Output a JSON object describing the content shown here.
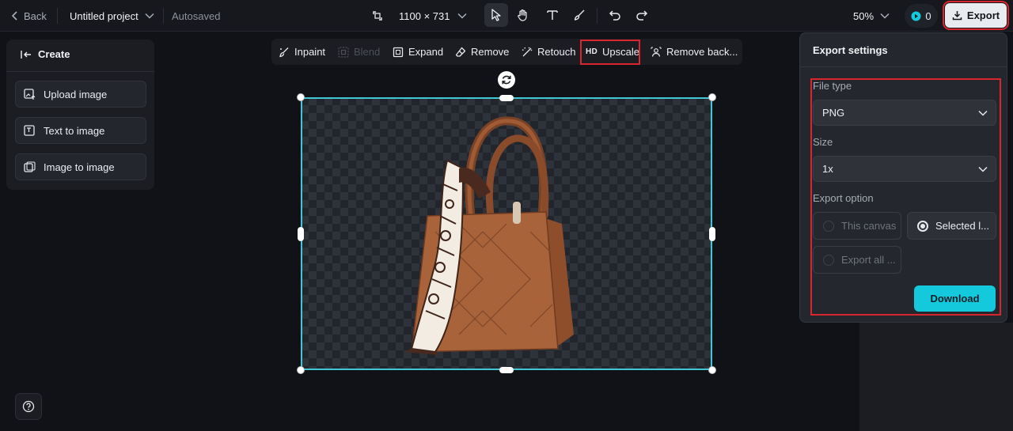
{
  "topbar": {
    "back_label": "Back",
    "project_title": "Untitled project",
    "autosave_status": "Autosaved",
    "canvas_size": "1100 × 731",
    "zoom": "50%",
    "credits": "0",
    "export_label": "Export"
  },
  "left_panel": {
    "header": "Create",
    "items": [
      {
        "label": "Upload image",
        "icon": "upload-image-icon"
      },
      {
        "label": "Text to image",
        "icon": "text-to-image-icon"
      },
      {
        "label": "Image to image",
        "icon": "image-to-image-icon"
      }
    ]
  },
  "canvas_toolbar": {
    "items": [
      {
        "label": "Inpaint",
        "disabled": false
      },
      {
        "label": "Blend",
        "disabled": true
      },
      {
        "label": "Expand",
        "disabled": false
      },
      {
        "label": "Remove",
        "disabled": false
      },
      {
        "label": "Retouch",
        "disabled": false
      },
      {
        "label": "Upscale",
        "badge": "HD",
        "disabled": false,
        "highlighted": true
      },
      {
        "label": "Remove back...",
        "disabled": false
      }
    ]
  },
  "export_panel": {
    "title": "Export settings",
    "file_type_label": "File type",
    "file_type_value": "PNG",
    "size_label": "Size",
    "size_value": "1x",
    "export_option_label": "Export option",
    "options": [
      {
        "label": "This canvas",
        "selected": false
      },
      {
        "label": "Selected l...",
        "selected": true
      },
      {
        "label": "Export all ...",
        "selected": false
      }
    ],
    "download_label": "Download"
  },
  "colors": {
    "accent": "#14c9dc",
    "selection": "#3fc7d6",
    "highlight_box": "#d9262e",
    "background": "#101217"
  }
}
